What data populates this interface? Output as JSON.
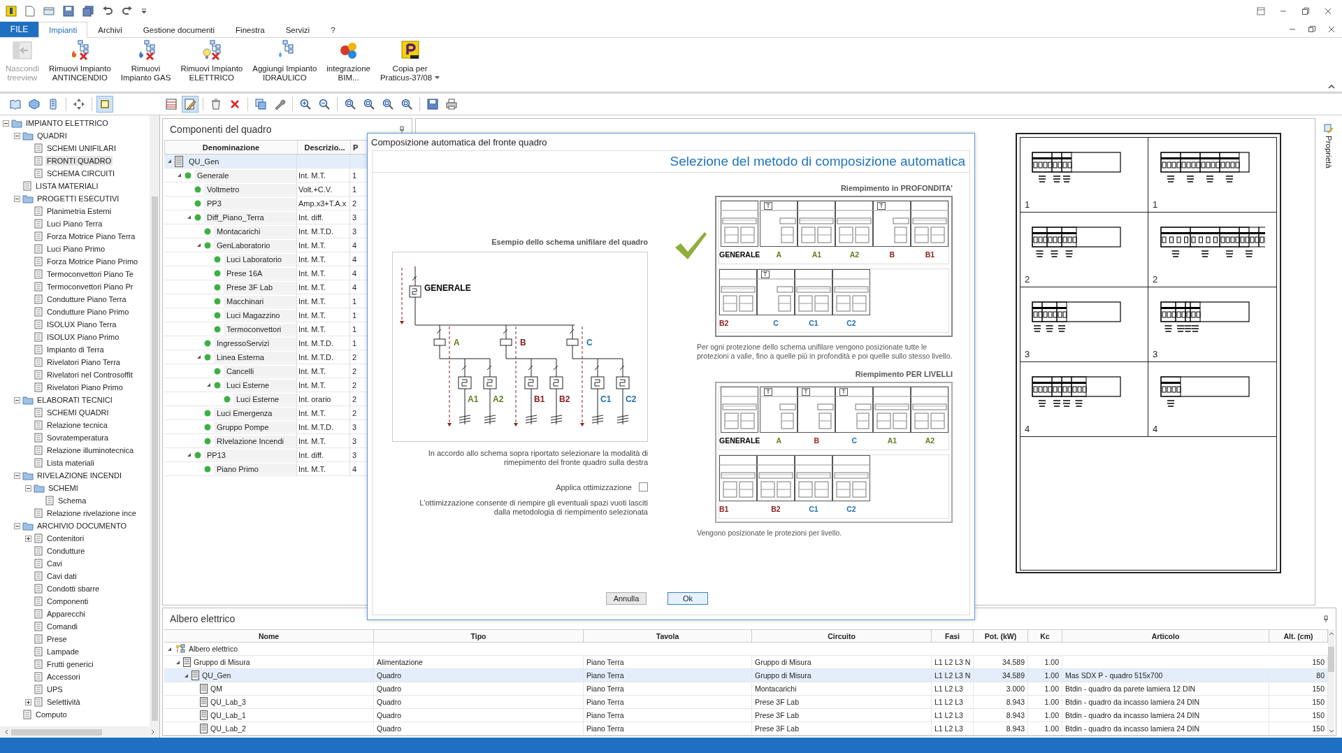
{
  "ribbon": {
    "file_tab": "FILE",
    "tabs": [
      {
        "label": "Impianti",
        "selected": true
      },
      {
        "label": "Archivi",
        "selected": false
      },
      {
        "label": "Gestione documenti",
        "selected": false
      },
      {
        "label": "Finestra",
        "selected": false
      },
      {
        "label": "Servizi",
        "selected": false
      },
      {
        "label": "?",
        "selected": false
      }
    ],
    "commands": [
      {
        "label_lines": [
          "Nascondi",
          "treeview"
        ],
        "disabled": true,
        "dropdown": false
      },
      {
        "label_lines": [
          "Rimuovi Impianto",
          "ANTINCENDIO"
        ],
        "disabled": false,
        "dropdown": false
      },
      {
        "label_lines": [
          "Rimuovi",
          "Impianto GAS"
        ],
        "disabled": false,
        "dropdown": false
      },
      {
        "label_lines": [
          "Rimuovi Impianto",
          "ELETTRICO"
        ],
        "disabled": false,
        "dropdown": false
      },
      {
        "label_lines": [
          "Aggiungi Impianto",
          "IDRAULICO"
        ],
        "disabled": false,
        "dropdown": false
      },
      {
        "label_lines": [
          "integrazione",
          "BIM..."
        ],
        "disabled": false,
        "dropdown": false
      },
      {
        "label_lines": [
          "Copia per",
          "Praticus-37/08"
        ],
        "disabled": false,
        "dropdown": true
      }
    ]
  },
  "left_toolbar": [
    {
      "pressed": false
    },
    {
      "pressed": false
    },
    {
      "pressed": false
    },
    {
      "pressed": false
    },
    {
      "pressed": true
    }
  ],
  "main_toolbar": [
    {
      "pressed": false
    },
    {
      "pressed": true
    },
    {
      "pressed": false
    },
    {
      "pressed": false
    },
    {
      "pressed": false
    },
    {
      "pressed": false
    },
    {
      "pressed": false
    },
    {
      "pressed": false
    },
    {
      "pressed": false
    },
    {
      "pressed": false
    },
    {
      "pressed": false
    },
    {
      "pressed": false
    },
    {
      "pressed": false
    },
    {
      "pressed": false
    }
  ],
  "project_tree": [
    {
      "label": "IMPIANTO ELETTRICO",
      "selected": false,
      "expanded": true,
      "children": [
        {
          "label": "QUADRI",
          "selected": false,
          "expanded": true,
          "children": [
            {
              "label": "SCHEMI UNIFILARI",
              "selected": false
            },
            {
              "label": "FRONTI QUADRO",
              "selected": true
            },
            {
              "label": "SCHEMA CIRCUITI",
              "selected": false
            }
          ]
        },
        {
          "label": "LISTA MATERIALI",
          "selected": false
        },
        {
          "label": "PROGETTI ESECUTIVI",
          "selected": false,
          "expanded": true,
          "children": [
            {
              "label": "Planimetria Esterni",
              "selected": false
            },
            {
              "label": "Luci Piano Terra",
              "selected": false
            },
            {
              "label": "Forza Motrice Piano Terra",
              "selected": false
            },
            {
              "label": "Luci Piano Primo",
              "selected": false
            },
            {
              "label": "Forza Motrice Piano Primo",
              "selected": false
            },
            {
              "label": "Termoconvettori  Piano Te",
              "selected": false
            },
            {
              "label": "Termoconvettori  Piano Pr",
              "selected": false
            },
            {
              "label": "Condutture Piano Terra",
              "selected": false
            },
            {
              "label": "Condutture Piano Primo",
              "selected": false
            },
            {
              "label": "ISOLUX Piano Terra",
              "selected": false
            },
            {
              "label": "ISOLUX Piano Primo",
              "selected": false
            },
            {
              "label": "Impianto di Terra",
              "selected": false
            },
            {
              "label": "Rivelatori Piano Terra",
              "selected": false
            },
            {
              "label": "Rivelatori nel Controsoffit",
              "selected": false
            },
            {
              "label": "Rivelatori Piano Primo",
              "selected": false
            }
          ]
        },
        {
          "label": "ELABORATI TECNICI",
          "selected": false,
          "expanded": true,
          "children": [
            {
              "label": "SCHEMI QUADRI",
              "selected": false
            },
            {
              "label": "Relazione tecnica",
              "selected": false
            },
            {
              "label": "Sovratemperatura",
              "selected": false
            },
            {
              "label": "Relazione illuminotecnica",
              "selected": false
            },
            {
              "label": "Lista materiali",
              "selected": false
            }
          ]
        },
        {
          "label": "RIVELAZIONE INCENDI",
          "selected": false,
          "expanded": true,
          "children": [
            {
              "label": "SCHEMI",
              "selected": false,
              "expanded": true,
              "children": [
                {
                  "label": "Schema",
                  "selected": false
                }
              ]
            },
            {
              "label": "Relazione rivelazione ince",
              "selected": false
            }
          ]
        },
        {
          "label": "ARCHIVIO DOCUMENTO",
          "selected": false,
          "expanded": true,
          "children": [
            {
              "label": "Contenitori",
              "selected": false,
              "expanded": false
            },
            {
              "label": "Condutture",
              "selected": false
            },
            {
              "label": "Cavi",
              "selected": false
            },
            {
              "label": "Cavi dati",
              "selected": false
            },
            {
              "label": "Condotti sbarre",
              "selected": false
            },
            {
              "label": "Componenti",
              "selected": false
            },
            {
              "label": "Apparecchi",
              "selected": false
            },
            {
              "label": "Comandi",
              "selected": false
            },
            {
              "label": "Prese",
              "selected": false
            },
            {
              "label": "Lampade",
              "selected": false
            },
            {
              "label": "Frutti generici",
              "selected": false
            },
            {
              "label": "Accessori",
              "selected": false
            },
            {
              "label": "UPS",
              "selected": false
            },
            {
              "label": "Selettività",
              "selected": false,
              "expanded": false
            }
          ]
        },
        {
          "label": "Computo",
          "selected": false
        }
      ]
    }
  ],
  "components_panel": {
    "title": "Componenti del quadro",
    "columns": [
      "Denominazione",
      "Descrizio...",
      "P"
    ],
    "rows": [
      {
        "name": "QU_Gen",
        "selected": true,
        "expanded": true,
        "children": [
          {
            "name": "Generale",
            "description": "Int. M.T.",
            "column_3": "1",
            "selected": false,
            "expanded": true,
            "children": [
              {
                "name": "Voltmetro",
                "description": "Volt.+C.V.",
                "column_3": "1",
                "selected": false
              },
              {
                "name": "PP3",
                "description": "Amp.x3+T.A.x",
                "column_3": "2",
                "selected": false
              },
              {
                "name": "Diff_Piano_Terra",
                "description": "Int. diff.",
                "column_3": "3",
                "selected": false,
                "expanded": true,
                "children": [
                  {
                    "name": "Montacarichi",
                    "description": "Int. M.T.D.",
                    "column_3": "3",
                    "selected": false
                  },
                  {
                    "name": "GenLaboratorio",
                    "description": "Int. M.T.",
                    "column_3": "4",
                    "selected": false,
                    "expanded": true,
                    "children": [
                      {
                        "name": "Luci Laboratorio",
                        "description": "Int. M.T.",
                        "column_3": "4",
                        "selected": false
                      },
                      {
                        "name": "Prese 16A",
                        "description": "Int. M.T.",
                        "column_3": "4",
                        "selected": false
                      },
                      {
                        "name": "Prese 3F Lab",
                        "description": "Int. M.T.",
                        "column_3": "4",
                        "selected": false
                      },
                      {
                        "name": "Macchinari",
                        "description": "Int. M.T.",
                        "column_3": "1",
                        "selected": false
                      },
                      {
                        "name": "Luci Magazzino",
                        "description": "Int. M.T.",
                        "column_3": "1",
                        "selected": false
                      },
                      {
                        "name": "Termoconvettori",
                        "description": "Int. M.T.",
                        "column_3": "1",
                        "selected": false
                      }
                    ]
                  },
                  {
                    "name": "IngressoServizi",
                    "description": "Int. M.T.D.",
                    "column_3": "1",
                    "selected": false
                  },
                  {
                    "name": "Linea Esterna",
                    "description": "Int. M.T.D.",
                    "column_3": "2",
                    "selected": false,
                    "expanded": true,
                    "children": [
                      {
                        "name": "Cancelli",
                        "description": "Int. M.T.",
                        "column_3": "2",
                        "selected": false
                      },
                      {
                        "name": "Luci Esterne",
                        "description": "Int. M.T.",
                        "column_3": "2",
                        "selected": false,
                        "expanded": true,
                        "children": [
                          {
                            "name": "Luci Esterne",
                            "description": "Int. orario",
                            "column_3": "2",
                            "selected": false
                          }
                        ]
                      }
                    ]
                  },
                  {
                    "name": "Luci Emergenza",
                    "description": "Int. M.T.",
                    "column_3": "2",
                    "selected": false
                  },
                  {
                    "name": "Gruppo Pompe",
                    "description": "Int. M.T.D.",
                    "column_3": "3",
                    "selected": false
                  },
                  {
                    "name": "RIvelazione Incendi",
                    "description": "Int. M.T.",
                    "column_3": "3",
                    "selected": false
                  }
                ]
              },
              {
                "name": "PP13",
                "description": "Int. diff.",
                "column_3": "3",
                "selected": false,
                "expanded": true,
                "children": [
                  {
                    "name": "Piano Primo",
                    "description": "Int. M.T.",
                    "column_3": "4",
                    "selected": false
                  }
                ]
              }
            ]
          }
        ]
      }
    ]
  },
  "dialog": {
    "title": "Composizione automatica del fronte quadro",
    "heading": "Selezione del metodo di composizione automatica",
    "schematic": {
      "title": "Esempio dello schema unifilare del quadro",
      "main_label": "GENERALE",
      "branches": [
        {
          "label": "A",
          "color": "#5f7f1f",
          "children": [
            {
              "label": "A1",
              "color": "#5f7f1f"
            },
            {
              "label": "A2",
              "color": "#5f7f1f"
            }
          ]
        },
        {
          "label": "B",
          "color": "#8b1c1c",
          "children": [
            {
              "label": "B1",
              "color": "#8b1c1c"
            },
            {
              "label": "B2",
              "color": "#8b1c1c"
            }
          ]
        },
        {
          "label": "C",
          "color": "#1f6fb4",
          "children": [
            {
              "label": "C1",
              "color": "#1f6fb4"
            },
            {
              "label": "C2",
              "color": "#1f6fb4"
            }
          ]
        }
      ]
    },
    "instructions": "In accordo allo schema sopra riportato selezionare la modalità di rimepimento del fronte quadro sulla destra",
    "optimize": {
      "label": "Applica ottimizzazione",
      "checked": false,
      "note": "L'ottimizzazione consente di riempire gli eventuali spazi vuoti lasciti dalla metodologia di riempimento selezionata"
    },
    "fill_options": [
      {
        "title": "Riempimento in PROFONDITA'",
        "selected": true,
        "description": "Per ogni protezione dello schema unifilare vengono posizionate tutte le protezioni a valle, fino a quelle più in profondità e poi quelle sullo stesso livello.",
        "rows": [
          [
            {
              "kind": "double",
              "label": "GENERALE",
              "color": "#000000"
            },
            {
              "kind": "single",
              "tag": "T",
              "label": "A",
              "color": "#5f7f1f"
            },
            {
              "kind": "double",
              "label": "A1",
              "color": "#5f7f1f"
            },
            {
              "kind": "double",
              "label": "A2",
              "color": "#5f7f1f"
            },
            {
              "kind": "single",
              "tag": "T",
              "label": "B",
              "color": "#8b1c1c"
            },
            {
              "kind": "double",
              "label": "B1",
              "color": "#8b1c1c"
            }
          ],
          [
            {
              "kind": "double",
              "label": "B2",
              "color": "#8b1c1c"
            },
            {
              "kind": "single",
              "tag": "T",
              "label": "C",
              "color": "#1f6fb4"
            },
            {
              "kind": "double",
              "label": "C1",
              "color": "#1f6fb4"
            },
            {
              "kind": "double",
              "label": "C2",
              "color": "#1f6fb4"
            }
          ]
        ]
      },
      {
        "title": "Riempimento PER LIVELLI",
        "selected": false,
        "description": "Vengono posizionate le protezioni per livello.",
        "rows": [
          [
            {
              "kind": "double",
              "label": "GENERALE",
              "color": "#000000"
            },
            {
              "kind": "single",
              "tag": "T",
              "label": "A",
              "color": "#5f7f1f"
            },
            {
              "kind": "single",
              "tag": "T",
              "label": "B",
              "color": "#8b1c1c"
            },
            {
              "kind": "single",
              "tag": "T",
              "label": "C",
              "color": "#1f6fb4"
            },
            {
              "kind": "double",
              "label": "A1",
              "color": "#5f7f1f"
            },
            {
              "kind": "double",
              "label": "A2",
              "color": "#5f7f1f"
            }
          ],
          [
            {
              "kind": "double",
              "label": "B1",
              "color": "#8b1c1c"
            },
            {
              "kind": "double",
              "label": "B2",
              "color": "#8b1c1c"
            },
            {
              "kind": "double",
              "label": "C1",
              "color": "#1f6fb4"
            },
            {
              "kind": "double",
              "label": "C2",
              "color": "#1f6fb4"
            }
          ]
        ]
      }
    ],
    "buttons": [
      {
        "label": "Annulla",
        "default": false
      },
      {
        "label": "Ok",
        "default": true
      }
    ]
  },
  "front_view": {
    "cells": [
      {
        "number": "1"
      },
      {
        "number": "1"
      },
      {
        "number": "2"
      },
      {
        "number": "2"
      },
      {
        "number": "3"
      },
      {
        "number": "3"
      },
      {
        "number": "4"
      },
      {
        "number": "4"
      }
    ]
  },
  "side_tab": "Proprietà",
  "electrical_tree": {
    "title": "Albero elettrico",
    "columns": [
      "Nome",
      "Tipo",
      "Tavola",
      "Circuito",
      "Fasi",
      "Pot. (kW)",
      "Kc",
      "Articolo",
      "Alt. (cm)"
    ],
    "rows": [
      {
        "nome": "Albero elettrico",
        "selected": false,
        "expanded": true,
        "children": [
          {
            "nome": "Gruppo di Misura",
            "tipo": "Alimentazione",
            "tavola": "Piano Terra",
            "circuito": "Gruppo di Misura",
            "fasi": "L1 L2 L3 N",
            "potenza": "34.589",
            "kc": "1.00",
            "altezza": "150",
            "selected": false,
            "expanded": true,
            "children": [
              {
                "nome": "QU_Gen",
                "tipo": "Quadro",
                "tavola": "Piano Terra",
                "circuito": "Gruppo di Misura",
                "fasi": "L1 L2 L3 N",
                "potenza": "34.589",
                "kc": "1.00",
                "articolo": "Mas SDX P - quadro 515x700",
                "altezza": "80",
                "selected": true,
                "expanded": true,
                "children": [
                  {
                    "nome": "QM",
                    "tipo": "Quadro",
                    "tavola": "Piano Terra",
                    "circuito": "Montacarichi",
                    "fasi": "L1 L2 L3",
                    "potenza": "3.000",
                    "kc": "1.00",
                    "articolo": "Btdin - quadro da parete lamiera 12 DIN",
                    "altezza": "150",
                    "selected": false
                  },
                  {
                    "nome": "QU_Lab_3",
                    "tipo": "Quadro",
                    "tavola": "Piano Terra",
                    "circuito": "Prese 3F Lab",
                    "fasi": "L1 L2 L3",
                    "potenza": "8.943",
                    "kc": "1.00",
                    "articolo": "Btdin - quadro da incasso lamiera 24 DIN",
                    "altezza": "150",
                    "selected": false
                  },
                  {
                    "nome": "QU_Lab_1",
                    "tipo": "Quadro",
                    "tavola": "Piano Terra",
                    "circuito": "Prese 3F Lab",
                    "fasi": "L1 L2 L3",
                    "potenza": "8.943",
                    "kc": "1.00",
                    "articolo": "Btdin - quadro da incasso lamiera 24 DIN",
                    "altezza": "150",
                    "selected": false
                  },
                  {
                    "nome": "QU_Lab_2",
                    "tipo": "Quadro",
                    "tavola": "Piano Terra",
                    "circuito": "Prese 3F Lab",
                    "fasi": "L1 L2 L3",
                    "potenza": "8.943",
                    "kc": "1.00",
                    "articolo": "Btdin - quadro da incasso lamiera 24 DIN",
                    "altezza": "150",
                    "selected": false
                  }
                ]
              }
            ]
          }
        ]
      }
    ]
  }
}
